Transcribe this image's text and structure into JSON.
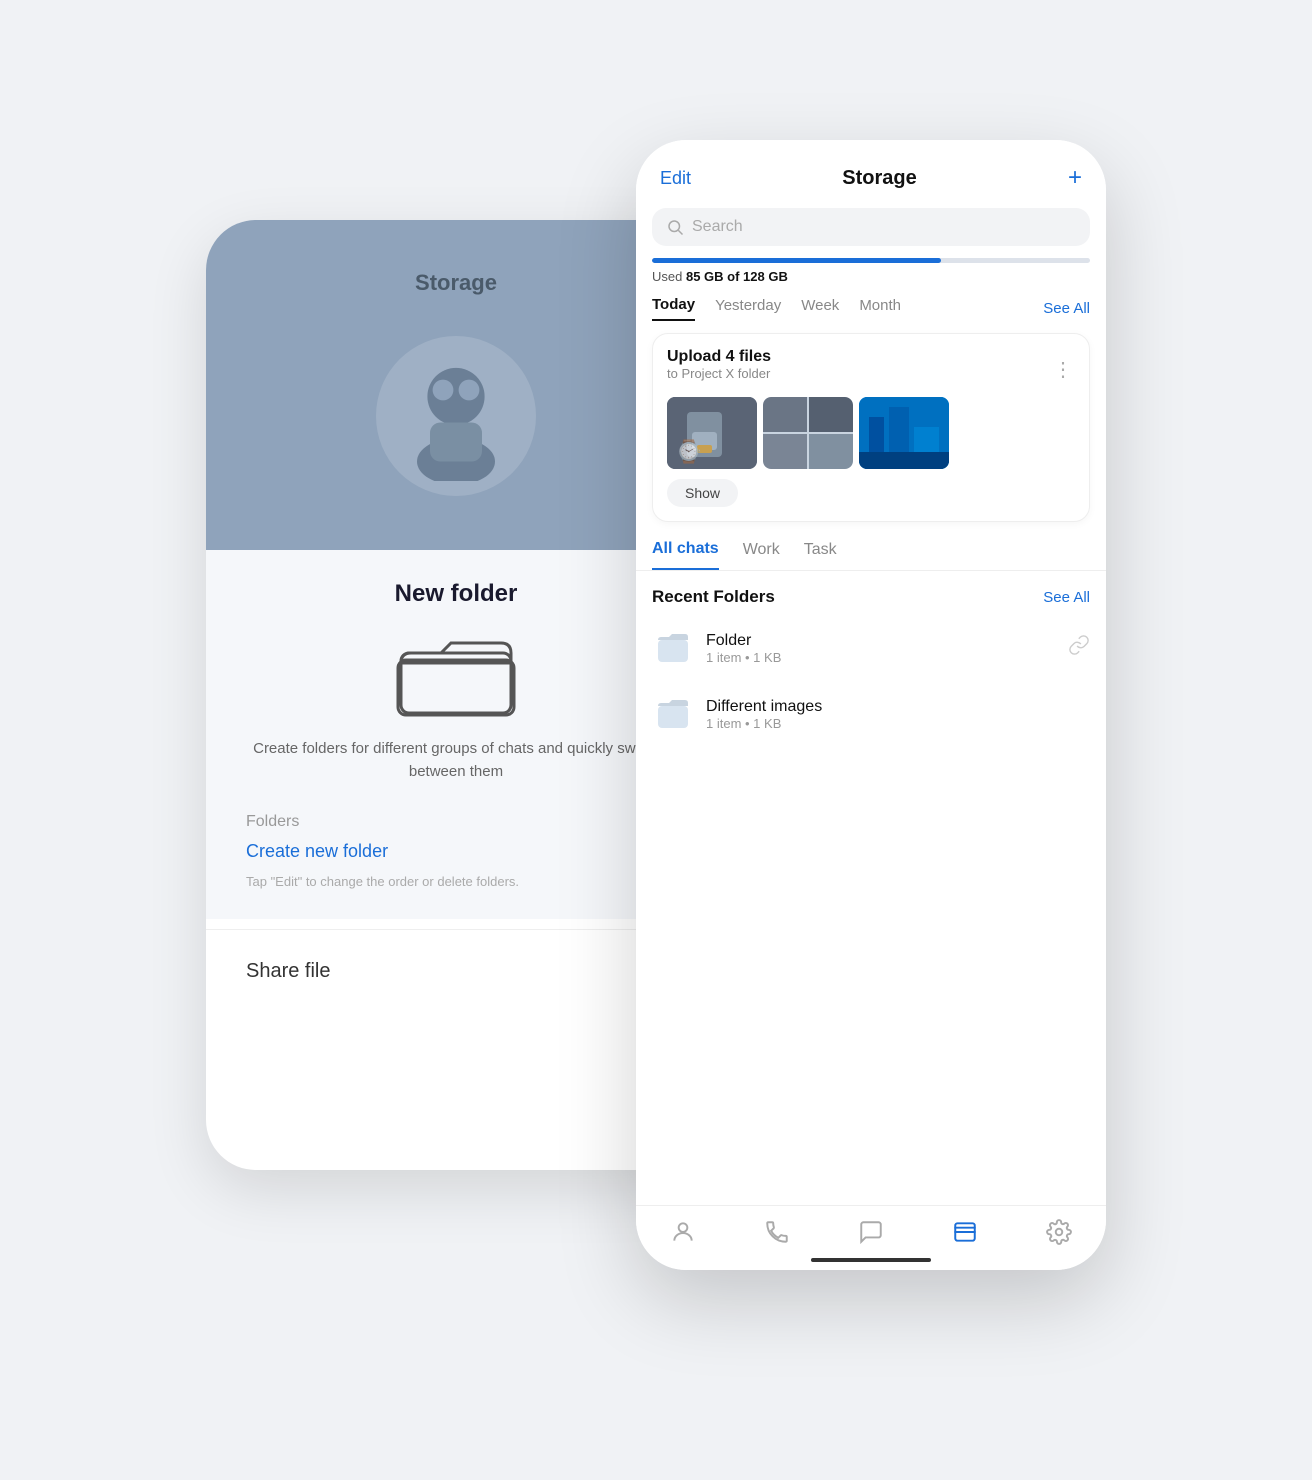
{
  "scene": {
    "background": "#f0f2f5"
  },
  "back_phone": {
    "title": "Storage",
    "new_folder_title": "New folder",
    "new_folder_desc": "Create folders for different groups of chats and quickly switch between them",
    "folders_label": "Folders",
    "create_folder_btn": "Create new folder",
    "tap_hint": "Tap \"Edit\" to change the order or delete folders.",
    "share_file_title": "Share file"
  },
  "front_phone": {
    "header": {
      "edit_label": "Edit",
      "title": "Storage",
      "plus_label": "+"
    },
    "search": {
      "placeholder": "Search"
    },
    "storage": {
      "used_gb": 85,
      "total_gb": 128,
      "fill_percent": 66,
      "label_prefix": "Used",
      "label": "85 GB of 128 GB"
    },
    "time_tabs": [
      {
        "label": "Today",
        "active": true
      },
      {
        "label": "Yesterday",
        "active": false
      },
      {
        "label": "Week",
        "active": false
      },
      {
        "label": "Month",
        "active": false
      }
    ],
    "see_all_label": "See All",
    "upload_card": {
      "title": "Upload 4 files",
      "subtitle": "to Project X folder",
      "show_btn": "Show"
    },
    "folder_tabs": [
      {
        "label": "All chats",
        "active": true
      },
      {
        "label": "Work",
        "active": false
      },
      {
        "label": "Task",
        "active": false
      }
    ],
    "recent_folders": {
      "title": "Recent Folders",
      "see_all": "See All",
      "items": [
        {
          "name": "Folder",
          "meta": "1 item • 1 KB"
        },
        {
          "name": "Different images",
          "meta": "1 item • 1 KB"
        }
      ]
    },
    "bottom_nav": [
      {
        "icon": "contacts-icon",
        "active": false
      },
      {
        "icon": "calls-icon",
        "active": false
      },
      {
        "icon": "chats-icon",
        "active": false
      },
      {
        "icon": "storage-icon",
        "active": true
      },
      {
        "icon": "settings-icon",
        "active": false
      }
    ]
  }
}
